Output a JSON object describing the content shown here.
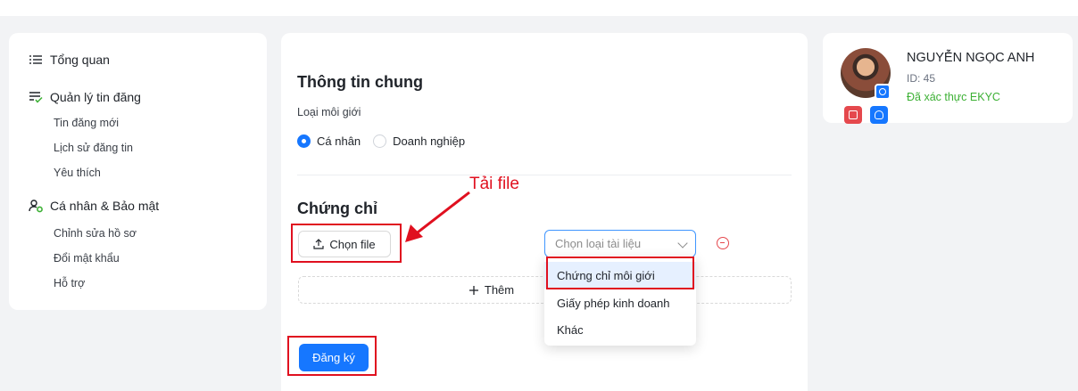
{
  "sidebar": {
    "overview": "Tổng quan",
    "listing_mgmt": "Quản lý tin đăng",
    "listing_items": [
      "Tin đăng mới",
      "Lịch sử đăng tin",
      "Yêu thích"
    ],
    "personal_security": "Cá nhân & Bảo mật",
    "personal_items": [
      "Chỉnh sửa hồ sơ",
      "Đổi mật khẩu",
      "Hỗ trợ"
    ],
    "icons": [
      "list-icon",
      "checklist-icon",
      "user-gear-icon"
    ]
  },
  "main": {
    "general_title": "Thông tin chung",
    "broker_type_label": "Loại môi giới",
    "radio_options": [
      "Cá nhân",
      "Doanh nghiệp"
    ],
    "selected_radio": "Cá nhân",
    "cert_title": "Chứng chỉ",
    "upload_button": "Chọn file",
    "doc_type_placeholder": "Chọn loại tài liệu",
    "add_label": "Thêm",
    "dropdown_options": [
      "Chứng chỉ môi giới",
      "Giấy phép kinh doanh",
      "Khác"
    ],
    "highlighted_option": "Chứng chỉ môi giới",
    "submit_button": "Đăng ký"
  },
  "annotation": {
    "text": "Tải file",
    "color": "#e0101f"
  },
  "profile": {
    "name": "NGUYỄN NGỌC ANH",
    "id": "ID: 45",
    "status": "Đã xác thực EKYC",
    "status_color": "#3cb034"
  },
  "colors": {
    "accent": "#1677ff",
    "danger": "#e5484d"
  }
}
